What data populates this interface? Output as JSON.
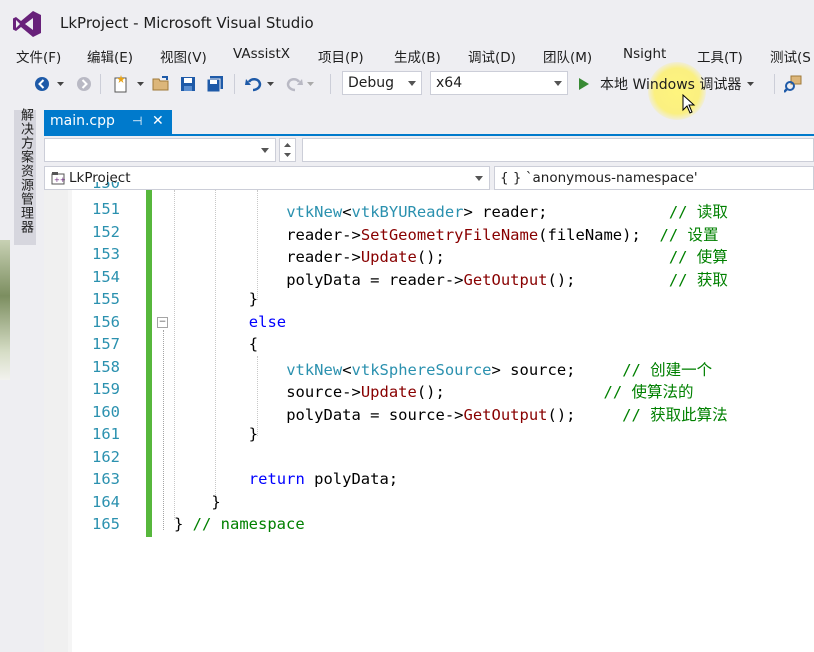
{
  "titlebar": {
    "title": "LkProject - Microsoft Visual Studio"
  },
  "menu": [
    "文件(F)",
    "编辑(E)",
    "视图(V)",
    "VAssistX",
    "项目(P)",
    "生成(B)",
    "调试(D)",
    "团队(M)",
    "Nsight",
    "工具(T)",
    "测试(S"
  ],
  "toolbar": {
    "configuration": "Debug",
    "platform": "x64",
    "run_label": "本地 Windows 调试器"
  },
  "sidebar": {
    "solution_explorer_label": "解决方案资源管理器"
  },
  "doc_tab": {
    "label": "main.cpp",
    "pin": "⊣",
    "close": "✕"
  },
  "navbar": {
    "project": "LkProject",
    "scope": "{ } `anonymous-namespace'"
  },
  "code_lines": [
    {
      "num": "151",
      "indent": 12,
      "tokens": [
        [
          "ty",
          "vtkNew"
        ],
        [
          "op",
          "<"
        ],
        [
          "ty",
          "vtkBYUReader"
        ],
        [
          "op",
          "> reader;"
        ],
        [
          "sp",
          "             "
        ],
        [
          "cm",
          "// 读取"
        ]
      ]
    },
    {
      "num": "152",
      "indent": 12,
      "tokens": [
        [
          "op",
          "reader->"
        ],
        [
          "fn",
          "SetGeometryFileName"
        ],
        [
          "op",
          "(fileName);  "
        ],
        [
          "cm",
          "// 设置"
        ]
      ]
    },
    {
      "num": "153",
      "indent": 12,
      "tokens": [
        [
          "op",
          "reader->"
        ],
        [
          "fn",
          "Update"
        ],
        [
          "op",
          "();"
        ],
        [
          "sp",
          "                        "
        ],
        [
          "cm",
          "// 使算"
        ]
      ]
    },
    {
      "num": "154",
      "indent": 12,
      "tokens": [
        [
          "op",
          "polyData = reader->"
        ],
        [
          "fn",
          "GetOutput"
        ],
        [
          "op",
          "();"
        ],
        [
          "sp",
          "          "
        ],
        [
          "cm",
          "// 获取"
        ]
      ]
    },
    {
      "num": "155",
      "indent": 8,
      "tokens": [
        [
          "op",
          "}"
        ]
      ]
    },
    {
      "num": "156",
      "indent": 8,
      "tokens": [
        [
          "kw",
          "else"
        ]
      ]
    },
    {
      "num": "157",
      "indent": 8,
      "tokens": [
        [
          "op",
          "{"
        ]
      ]
    },
    {
      "num": "158",
      "indent": 12,
      "tokens": [
        [
          "ty",
          "vtkNew"
        ],
        [
          "op",
          "<"
        ],
        [
          "ty",
          "vtkSphereSource"
        ],
        [
          "op",
          "> source;"
        ],
        [
          "sp",
          "     "
        ],
        [
          "cm",
          "// 创建一个"
        ]
      ]
    },
    {
      "num": "159",
      "indent": 12,
      "tokens": [
        [
          "op",
          "source->"
        ],
        [
          "fn",
          "Update"
        ],
        [
          "op",
          "();"
        ],
        [
          "sp",
          "                 "
        ],
        [
          "cm",
          "// 使算法的"
        ]
      ]
    },
    {
      "num": "160",
      "indent": 12,
      "tokens": [
        [
          "op",
          "polyData = source->"
        ],
        [
          "fn",
          "GetOutput"
        ],
        [
          "op",
          "();"
        ],
        [
          "sp",
          "     "
        ],
        [
          "cm",
          "// 获取此算法"
        ]
      ]
    },
    {
      "num": "161",
      "indent": 8,
      "tokens": [
        [
          "op",
          "}"
        ]
      ]
    },
    {
      "num": "162",
      "indent": 0,
      "tokens": []
    },
    {
      "num": "163",
      "indent": 8,
      "tokens": [
        [
          "kw",
          "return"
        ],
        [
          "op",
          " polyData;"
        ]
      ]
    },
    {
      "num": "164",
      "indent": 4,
      "tokens": [
        [
          "op",
          "}"
        ]
      ]
    },
    {
      "num": "165",
      "indent": 0,
      "tokens": [
        [
          "op",
          "} "
        ],
        [
          "cm",
          "// namespace"
        ]
      ]
    }
  ],
  "colors": {
    "accent": "#007acc",
    "change_bar": "#57b73c",
    "line_number": "#2b91af",
    "keyword": "#0000ff",
    "comment": "#008000",
    "function": "#880000"
  }
}
